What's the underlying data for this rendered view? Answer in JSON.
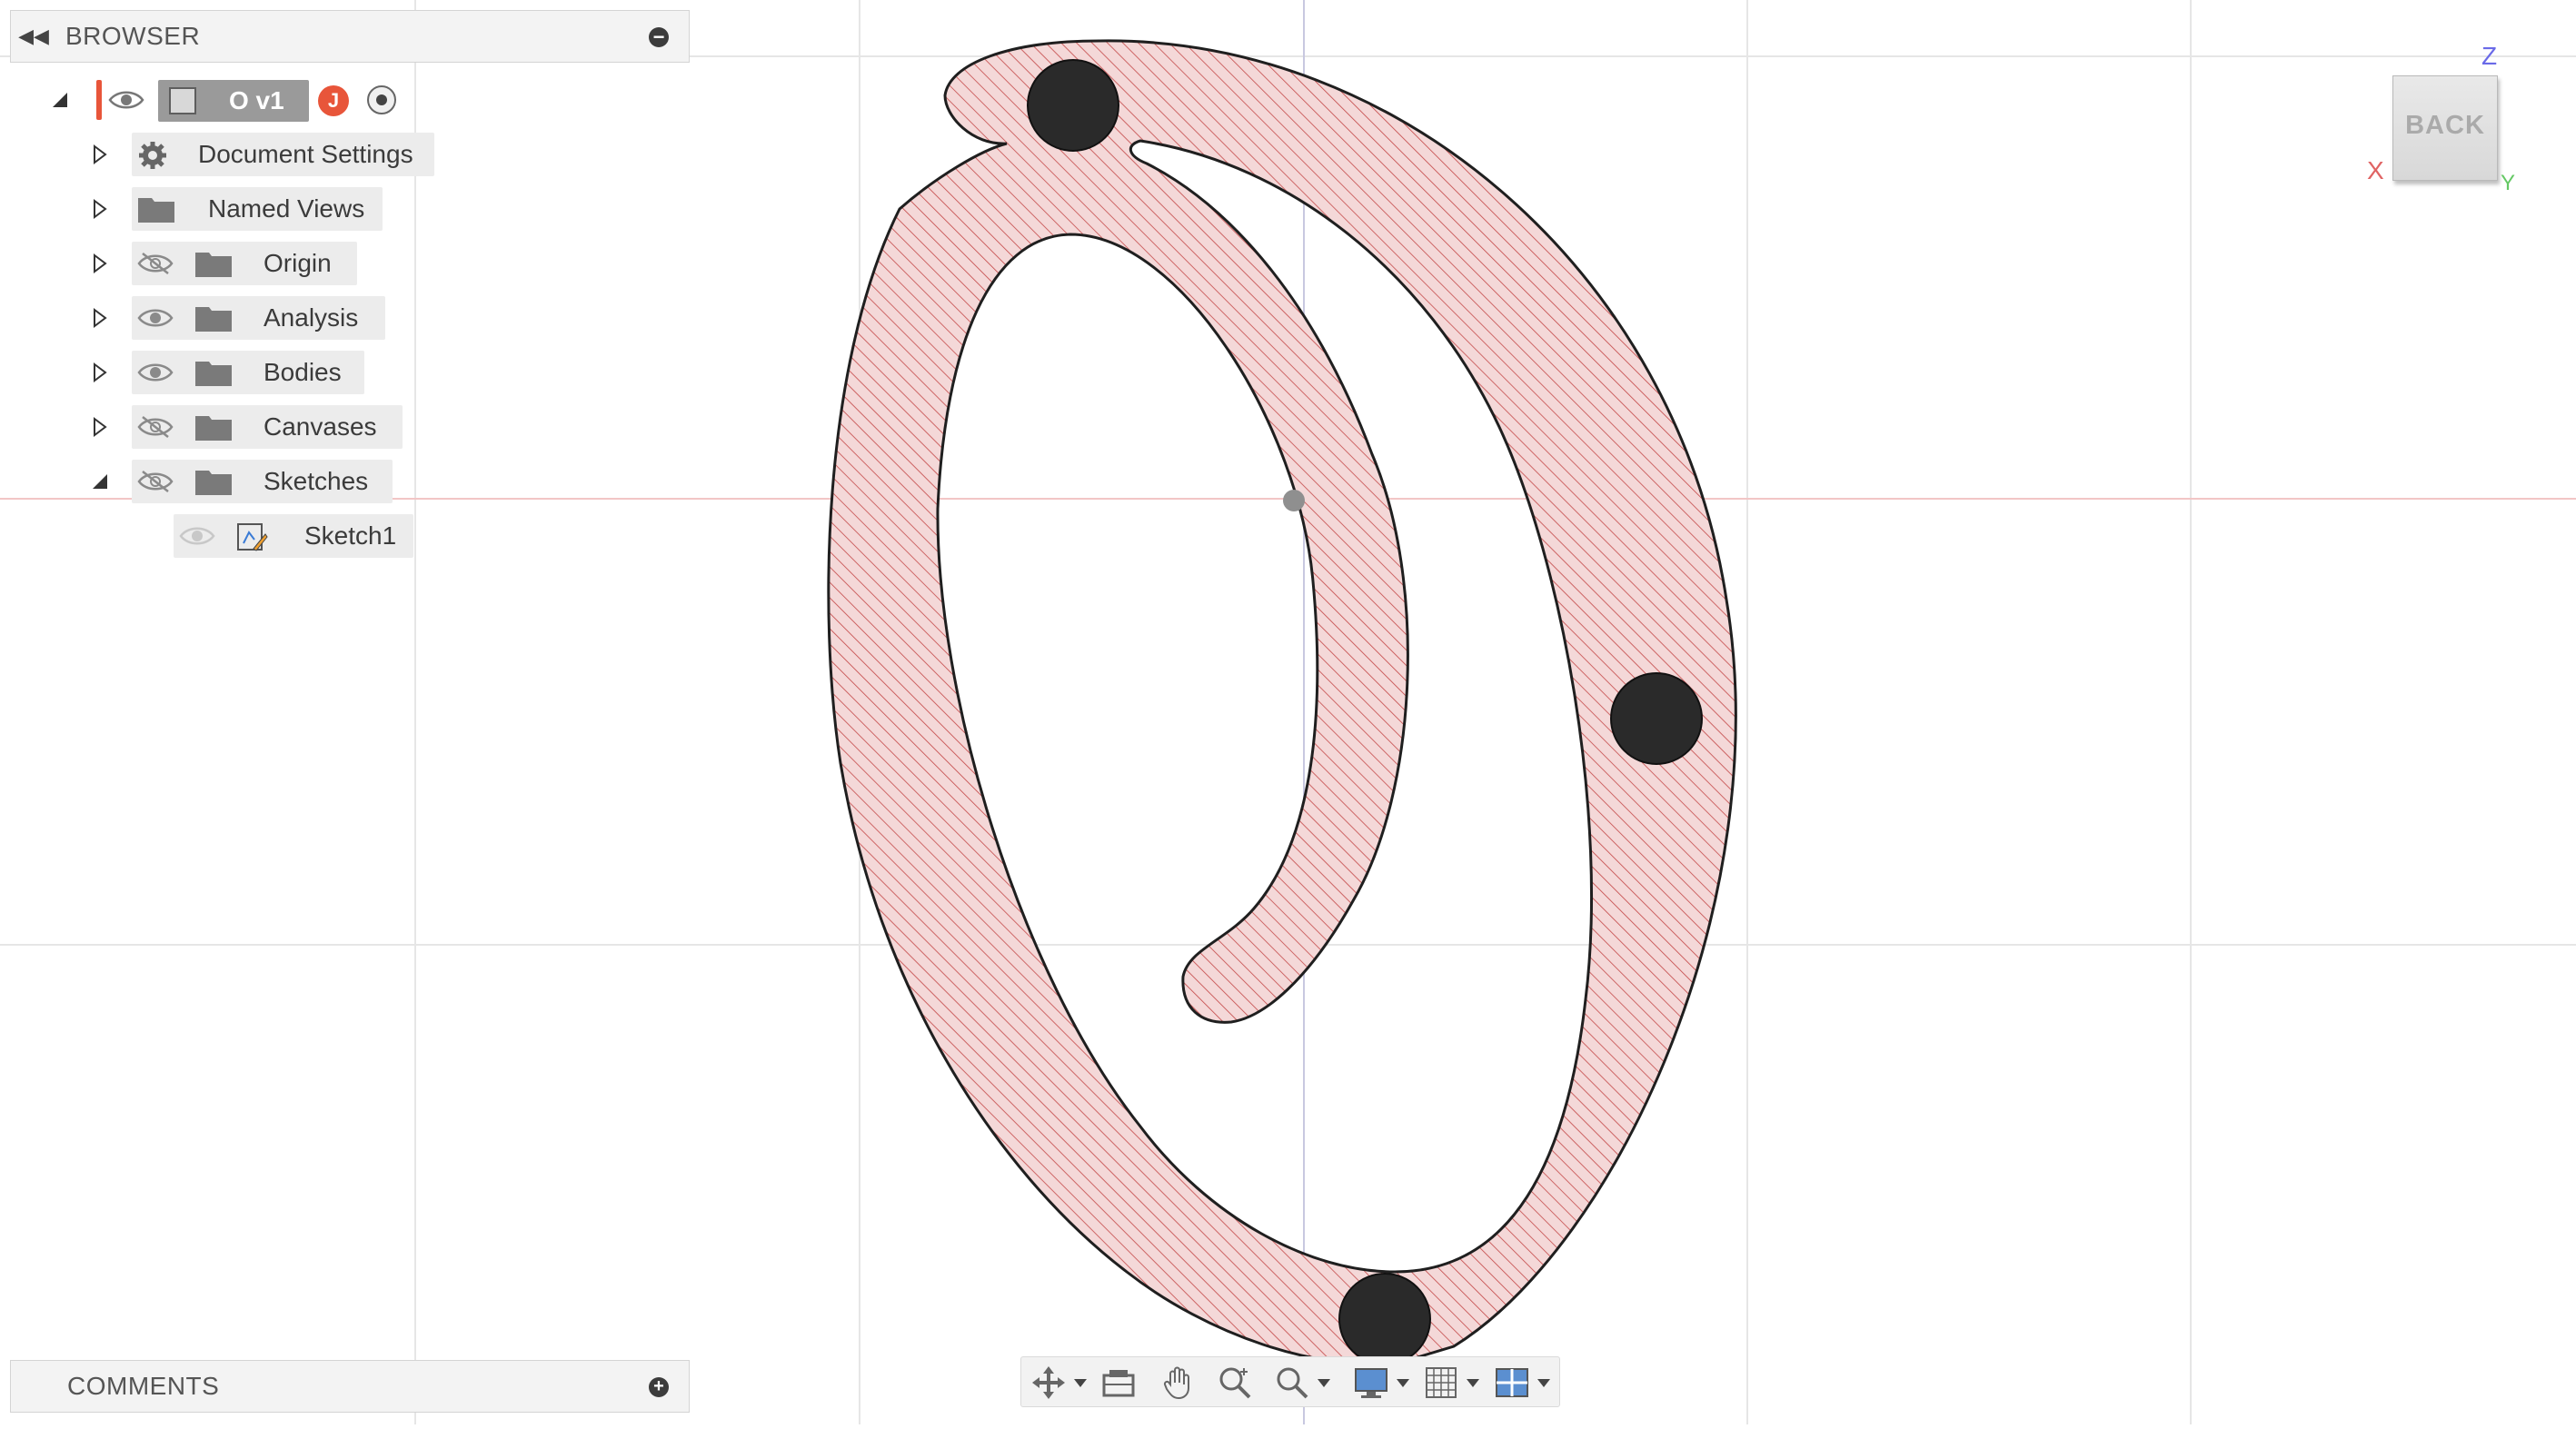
{
  "browser": {
    "title": "BROWSER",
    "root": {
      "label": "O v1",
      "user_initial": "J"
    },
    "items": [
      {
        "label": "Document Settings"
      },
      {
        "label": "Named Views"
      },
      {
        "label": "Origin"
      },
      {
        "label": "Analysis"
      },
      {
        "label": "Bodies"
      },
      {
        "label": "Canvases"
      },
      {
        "label": "Sketches"
      },
      {
        "label": "Sketch1"
      }
    ]
  },
  "comments": {
    "title": "COMMENTS"
  },
  "viewcube": {
    "face": "BACK",
    "axis_z": "Z",
    "axis_x": "X",
    "axis_y": "Y"
  },
  "toolbar": {
    "icons": [
      "orbit-icon",
      "look-at-icon",
      "pan-icon",
      "zoom-window-icon",
      "zoom-fit-icon",
      "display-settings-icon",
      "grid-snaps-icon",
      "viewports-icon"
    ]
  },
  "colors": {
    "sketch_fill": "#f4d6d6",
    "sketch_hatch": "#c0392b",
    "root_accent": "#e8553a",
    "axis_x": "#e06464",
    "axis_y": "#64c864",
    "axis_z": "#6a6ae8"
  }
}
